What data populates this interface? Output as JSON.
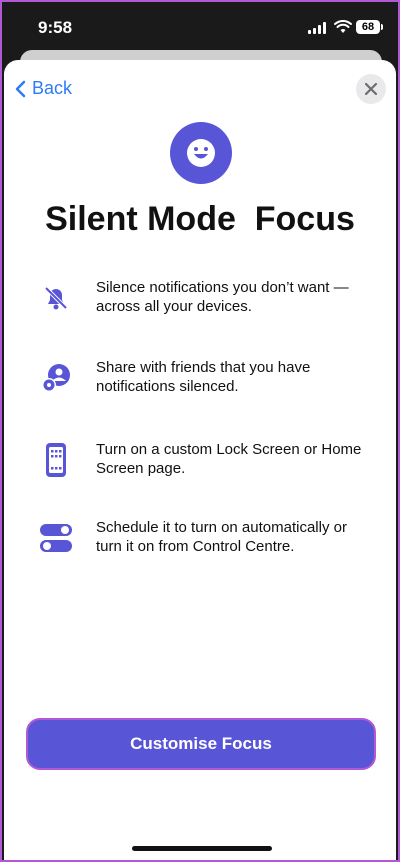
{
  "status_bar": {
    "time": "9:58",
    "battery": "68"
  },
  "nav": {
    "back_label": "Back"
  },
  "title": "Silent Mode  Focus",
  "features": [
    {
      "icon": "bell-slash-icon",
      "text": "Silence notifications you don’t want — across all your devices."
    },
    {
      "icon": "share-person-icon",
      "text": "Share with friends that you have notifications silenced."
    },
    {
      "icon": "phone-screen-icon",
      "text": "Turn on a custom Lock Screen or Home Screen page."
    },
    {
      "icon": "toggles-icon",
      "text": "Schedule it to turn on automatically or turn it on from Control Centre."
    }
  ],
  "cta_label": "Customise Focus",
  "colors": {
    "accent": "#5856d6",
    "link": "#2f7bf5",
    "highlight": "#b259d8"
  }
}
